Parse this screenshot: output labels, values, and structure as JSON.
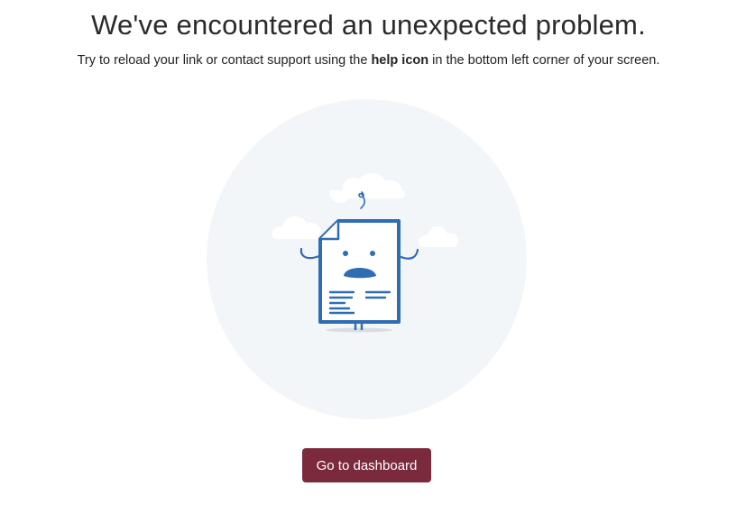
{
  "header": {
    "title": "We've encountered an unexpected problem.",
    "subtitle_before": "Try to reload your link or contact support using the ",
    "subtitle_bold": "help icon",
    "subtitle_after": " in the bottom left corner of your screen."
  },
  "illustration": {
    "icon": "confused-document-icon",
    "circle_color": "#f3f6f9",
    "stroke_color": "#2f6db3",
    "cloud_color": "#ffffff"
  },
  "actions": {
    "dashboard_label": "Go to dashboard",
    "button_color": "#7b2a3d"
  }
}
